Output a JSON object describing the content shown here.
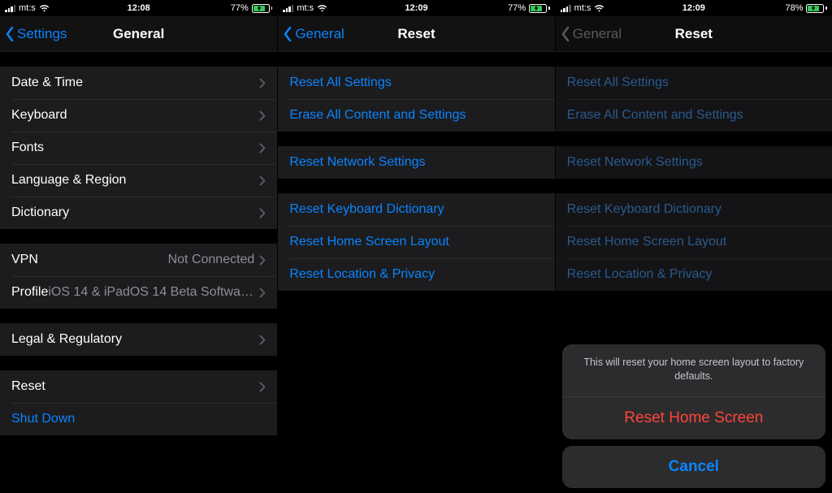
{
  "panels": [
    {
      "status": {
        "carrier": "mt:s",
        "time": "12:08",
        "battery_pct": "77%",
        "battery_fill": 77
      },
      "nav": {
        "back": "Settings",
        "title": "General"
      },
      "groups": [
        {
          "rows": [
            {
              "label": "Date & Time"
            },
            {
              "label": "Keyboard"
            },
            {
              "label": "Fonts"
            },
            {
              "label": "Language & Region"
            },
            {
              "label": "Dictionary"
            }
          ]
        },
        {
          "rows": [
            {
              "label": "VPN",
              "value": "Not Connected"
            },
            {
              "label": "Profile",
              "value": "iOS 14 & iPadOS 14 Beta Softwar..."
            }
          ]
        },
        {
          "rows": [
            {
              "label": "Legal & Regulatory"
            }
          ]
        },
        {
          "rows": [
            {
              "label": "Reset"
            },
            {
              "label": "Shut Down",
              "link": true,
              "no_chevron": true
            }
          ]
        }
      ]
    },
    {
      "status": {
        "carrier": "mt:s",
        "time": "12:09",
        "battery_pct": "77%",
        "battery_fill": 77
      },
      "nav": {
        "back": "General",
        "title": "Reset"
      },
      "groups": [
        {
          "rows": [
            {
              "label": "Reset All Settings",
              "link": true,
              "no_chevron": true
            },
            {
              "label": "Erase All Content and Settings",
              "link": true,
              "no_chevron": true
            }
          ]
        },
        {
          "rows": [
            {
              "label": "Reset Network Settings",
              "link": true,
              "no_chevron": true
            }
          ]
        },
        {
          "rows": [
            {
              "label": "Reset Keyboard Dictionary",
              "link": true,
              "no_chevron": true
            },
            {
              "label": "Reset Home Screen Layout",
              "link": true,
              "no_chevron": true
            },
            {
              "label": "Reset Location & Privacy",
              "link": true,
              "no_chevron": true
            }
          ]
        }
      ]
    },
    {
      "status": {
        "carrier": "mt:s",
        "time": "12:09",
        "battery_pct": "78%",
        "battery_fill": 78
      },
      "nav": {
        "back": "General",
        "title": "Reset",
        "dimmed": true
      },
      "groups": [
        {
          "rows": [
            {
              "label": "Reset All Settings",
              "link": true,
              "no_chevron": true,
              "dimmed": true
            },
            {
              "label": "Erase All Content and Settings",
              "link": true,
              "no_chevron": true,
              "dimmed": true
            }
          ]
        },
        {
          "rows": [
            {
              "label": "Reset Network Settings",
              "link": true,
              "no_chevron": true,
              "dimmed": true
            }
          ]
        },
        {
          "rows": [
            {
              "label": "Reset Keyboard Dictionary",
              "link": true,
              "no_chevron": true,
              "dimmed": true
            },
            {
              "label": "Reset Home Screen Layout",
              "link": true,
              "no_chevron": true,
              "dimmed": true
            },
            {
              "label": "Reset Location & Privacy",
              "link": true,
              "no_chevron": true,
              "dimmed": true
            }
          ]
        }
      ],
      "sheet": {
        "message": "This will reset your home screen layout to factory defaults.",
        "action": "Reset Home Screen",
        "cancel": "Cancel"
      }
    }
  ]
}
